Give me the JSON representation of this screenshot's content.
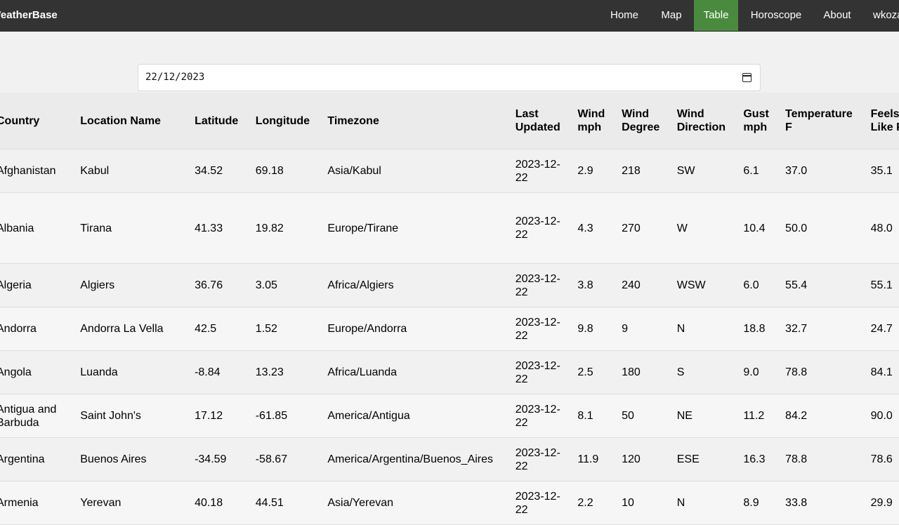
{
  "nav": {
    "brand": "WeatherBase",
    "items": [
      "Home",
      "Map",
      "Table",
      "Horoscope",
      "About",
      "wkoza"
    ]
  },
  "date_input": {
    "value": "22/12/2023"
  },
  "table": {
    "headers": {
      "country": "Country",
      "location": "Location Name",
      "latitude": "Latitude",
      "longitude": "Longitude",
      "timezone": "Timezone",
      "last_updated": "Last Updated",
      "wind_mph": "Wind mph",
      "wind_degree": "Wind Degree",
      "wind_direction": "Wind Direction",
      "gust_mph": "Gust mph",
      "temperature_f": "Temperature F",
      "feels_like_f": "Feels Like F"
    },
    "rows": [
      [
        "Afghanistan",
        "Kabul",
        "34.52",
        "69.18",
        "Asia/Kabul",
        "2023-12-22",
        "2.9",
        "218",
        "SW",
        "6.1",
        "37.0",
        "35.1"
      ],
      [
        "Albania",
        "Tirana",
        "41.33",
        "19.82",
        "Europe/Tirane",
        "2023-12-22",
        "4.3",
        "270",
        "W",
        "10.4",
        "50.0",
        "48.0"
      ],
      [
        "Algeria",
        "Algiers",
        "36.76",
        "3.05",
        "Africa/Algiers",
        "2023-12-22",
        "3.8",
        "240",
        "WSW",
        "6.0",
        "55.4",
        "55.1"
      ],
      [
        "Andorra",
        "Andorra La Vella",
        "42.5",
        "1.52",
        "Europe/Andorra",
        "2023-12-22",
        "9.8",
        "9",
        "N",
        "18.8",
        "32.7",
        "24.7"
      ],
      [
        "Angola",
        "Luanda",
        "-8.84",
        "13.23",
        "Africa/Luanda",
        "2023-12-22",
        "2.5",
        "180",
        "S",
        "9.0",
        "78.8",
        "84.1"
      ],
      [
        "Antigua and Barbuda",
        "Saint John's",
        "17.12",
        "-61.85",
        "America/Antigua",
        "2023-12-22",
        "8.1",
        "50",
        "NE",
        "11.2",
        "84.2",
        "90.0"
      ],
      [
        "Argentina",
        "Buenos Aires",
        "-34.59",
        "-58.67",
        "America/Argentina/Buenos_Aires",
        "2023-12-22",
        "11.9",
        "120",
        "ESE",
        "16.3",
        "78.8",
        "78.6"
      ],
      [
        "Armenia",
        "Yerevan",
        "40.18",
        "44.51",
        "Asia/Yerevan",
        "2023-12-22",
        "2.2",
        "10",
        "N",
        "8.9",
        "33.8",
        "29.9"
      ]
    ]
  }
}
